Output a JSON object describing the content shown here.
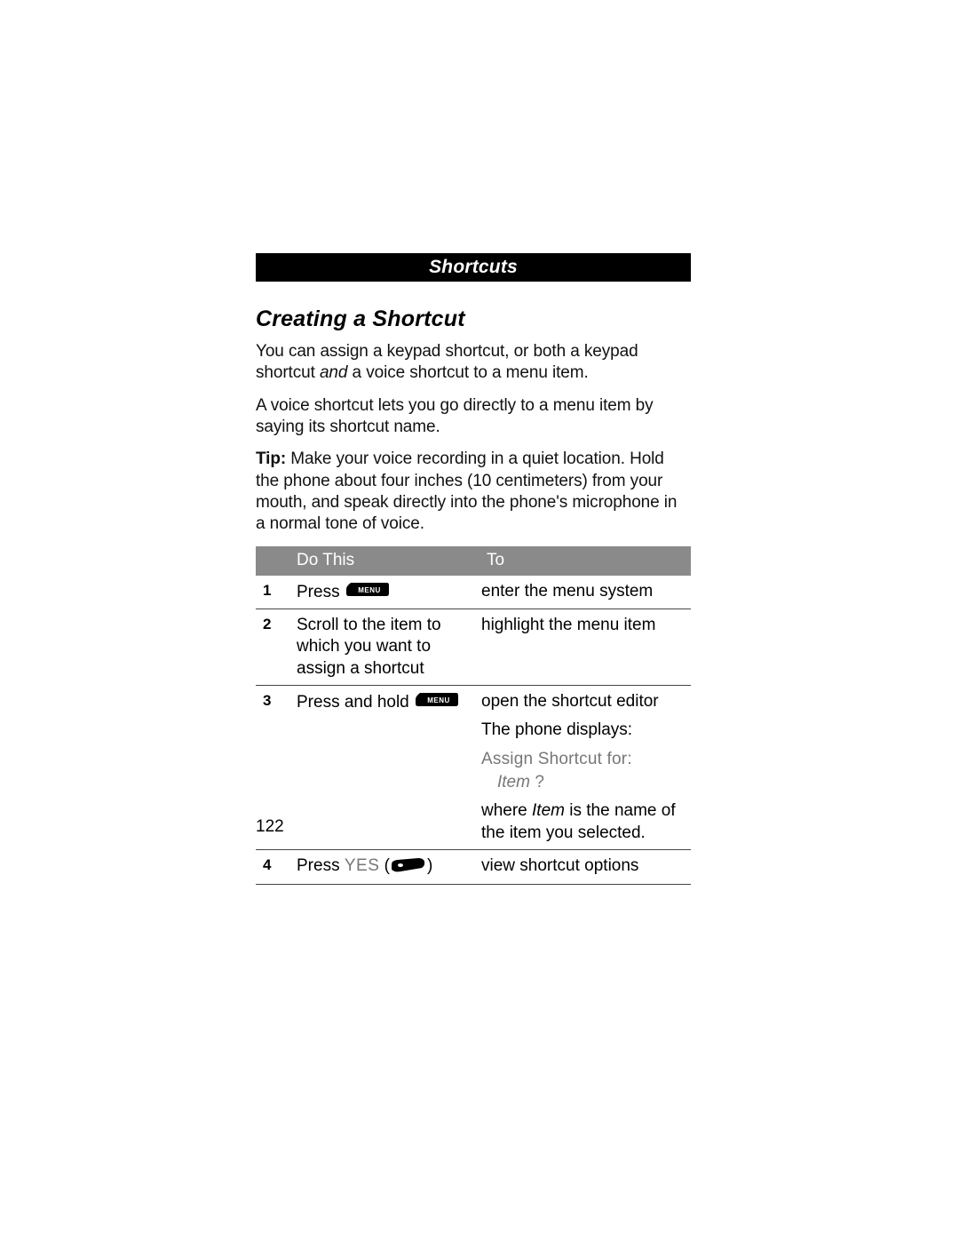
{
  "banner": "Shortcuts",
  "heading": "Creating a Shortcut",
  "para1_pre": "You can assign a keypad shortcut, or both a keypad shortcut ",
  "para1_italic": "and",
  "para1_post": " a voice shortcut to a menu item.",
  "para2": "A voice shortcut lets you go directly to a menu item by saying its shortcut name.",
  "tip_label": "Tip:",
  "tip_body": " Make your voice recording in a quiet location. Hold the phone about four inches (10 centimeters) from your mouth, and speak directly into the phone's microphone in a normal tone of voice.",
  "table": {
    "head_do": "Do This",
    "head_to": "To",
    "rows": [
      {
        "n": "1",
        "do_pre": "Press ",
        "do_post": "",
        "to": "enter the menu system"
      },
      {
        "n": "2",
        "do": "Scroll to the item to which you want to assign a shortcut",
        "to": "highlight the menu item"
      },
      {
        "n": "3",
        "do_pre": "Press and hold ",
        "to_line1": "open the shortcut editor",
        "to_line2": "The phone displays:",
        "to_display1": "Assign Shortcut for:",
        "to_display2_item": "Item",
        "to_display2_q": " ?",
        "to_line3_pre": "where ",
        "to_line3_item": "Item",
        "to_line3_post": " is the name of the item you selected."
      },
      {
        "n": "4",
        "do_pre": "Press ",
        "do_yes": "YES",
        "do_paren_open": " (",
        "do_paren_close": ")",
        "to": "view shortcut options"
      }
    ]
  },
  "page_number": "122",
  "icons": {
    "menu_label": "MENU"
  }
}
